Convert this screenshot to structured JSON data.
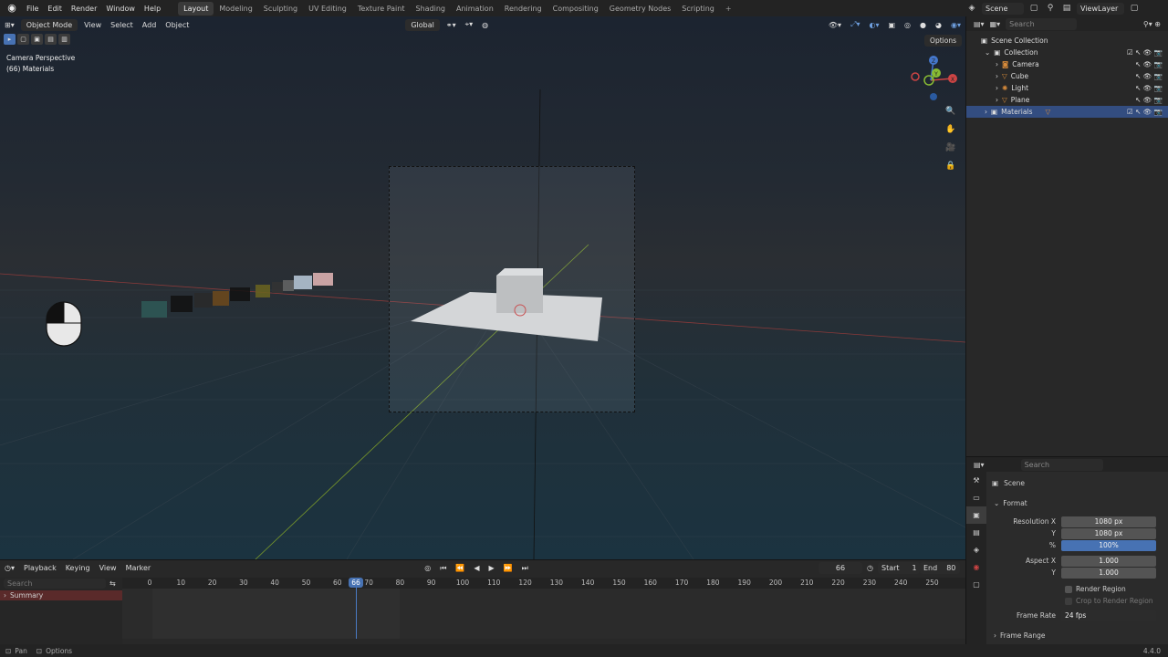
{
  "topbar": {
    "menu": [
      "File",
      "Edit",
      "Render",
      "Window",
      "Help"
    ],
    "tabs": [
      "Layout",
      "Modeling",
      "Sculpting",
      "UV Editing",
      "Texture Paint",
      "Shading",
      "Animation",
      "Rendering",
      "Compositing",
      "Geometry Nodes",
      "Scripting"
    ],
    "active_tab": "Layout",
    "scene": "Scene",
    "view_layer": "ViewLayer"
  },
  "viewport": {
    "mode": "Object Mode",
    "menus": [
      "View",
      "Select",
      "Add",
      "Object"
    ],
    "transform": "Global",
    "options_label": "Options",
    "camera_label": "Camera Perspective",
    "collection_label": "(66) Materials",
    "gizmo_axes": [
      "X",
      "Y",
      "Z"
    ]
  },
  "outliner": {
    "search_placeholder": "Search",
    "root": "Scene Collection",
    "collection": "Collection",
    "items": [
      "Camera",
      "Cube",
      "Light",
      "Plane"
    ],
    "materials": "Materials"
  },
  "properties": {
    "search_placeholder": "Search",
    "scene_label": "Scene",
    "format_section": "Format",
    "resolution_x_label": "Resolution X",
    "resolution_x": "1080 px",
    "y_label": "Y",
    "resolution_y": "1080 px",
    "percent_label": "%",
    "percent": "100%",
    "aspect_x_label": "Aspect X",
    "aspect_x": "1.000",
    "aspect_y_label": "Y",
    "aspect_y": "1.000",
    "render_region": "Render Region",
    "crop_region": "Crop to Render Region",
    "frame_rate_label": "Frame Rate",
    "frame_rate": "24 fps",
    "frame_range_section": "Frame Range"
  },
  "timeline": {
    "menus": [
      "Playback",
      "Keying",
      "View",
      "Marker"
    ],
    "current_frame": "66",
    "start_label": "Start",
    "start": "1",
    "end_label": "End",
    "end": "80",
    "search_placeholder": "Search",
    "summary": "Summary",
    "ruler": [
      "0",
      "10",
      "20",
      "30",
      "40",
      "50",
      "60",
      "70",
      "80",
      "90",
      "100",
      "110",
      "120",
      "130",
      "140",
      "150",
      "160",
      "170",
      "180",
      "190",
      "200",
      "210",
      "220",
      "230",
      "240",
      "250"
    ]
  },
  "statusbar": {
    "pan": "Pan",
    "options": "Options",
    "version": "4.4.0"
  },
  "colors": {
    "accent": "#4772b3",
    "selected_row": "#334d80"
  }
}
